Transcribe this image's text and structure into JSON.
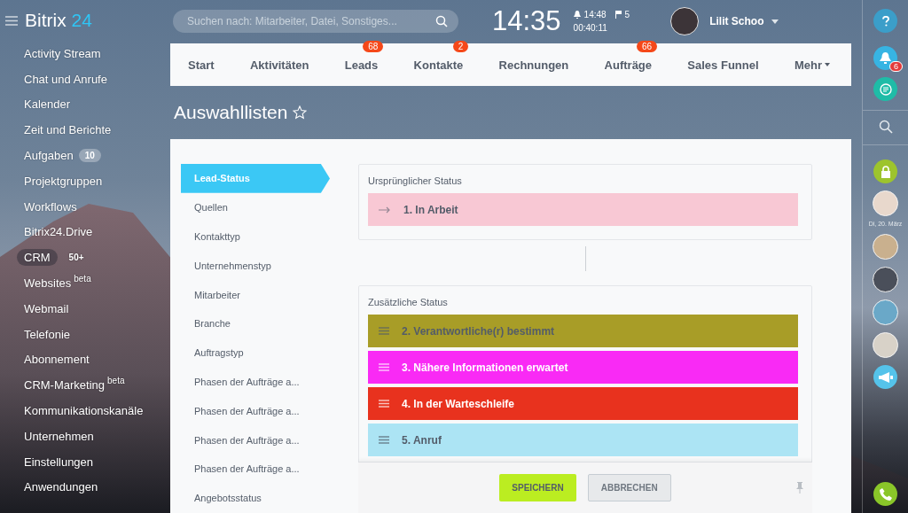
{
  "logo": {
    "name": "Bitrix",
    "number": "24"
  },
  "sidebar": {
    "items": [
      {
        "label": "Activity Stream",
        "selected": false
      },
      {
        "label": "Chat und Anrufe",
        "selected": false
      },
      {
        "label": "Kalender",
        "selected": false
      },
      {
        "label": "Zeit und Berichte",
        "selected": false
      },
      {
        "label": "Aufgaben",
        "count": "10",
        "selected": false
      },
      {
        "label": "Projektgruppen",
        "selected": false
      },
      {
        "label": "Workflows",
        "selected": false
      },
      {
        "label": "Bitrix24.Drive",
        "selected": false
      },
      {
        "label": "CRM",
        "count": "50+",
        "selected": true
      },
      {
        "label": "Websites",
        "sup": "beta",
        "selected": false
      },
      {
        "label": "Webmail",
        "selected": false
      },
      {
        "label": "Telefonie",
        "selected": false
      },
      {
        "label": "Abonnement",
        "selected": false
      },
      {
        "label": "CRM-Marketing",
        "sup": "beta",
        "selected": false
      },
      {
        "label": "Kommunikationskanäle",
        "selected": false
      },
      {
        "label": "Unternehmen",
        "selected": false
      },
      {
        "label": "Einstellungen",
        "selected": false
      },
      {
        "label": "Anwendungen",
        "selected": false
      }
    ]
  },
  "header": {
    "search": {
      "placeholder": "Suchen nach: Mitarbeiter, Datei, Sonstiges..."
    },
    "clock": "14:35",
    "alarm": "14:48",
    "flags": "5",
    "timer": "00:40:11",
    "user": "Lilit Schoo"
  },
  "nav": [
    {
      "label": "Start"
    },
    {
      "label": "Aktivitäten"
    },
    {
      "label": "Leads",
      "badge": "68"
    },
    {
      "label": "Kontakte",
      "badge": "2"
    },
    {
      "label": "Rechnungen"
    },
    {
      "label": "Aufträge",
      "badge": "66"
    },
    {
      "label": "Sales Funnel"
    },
    {
      "label": "Mehr",
      "dropdown": true
    }
  ],
  "page_title": "Auswahllisten",
  "lists": [
    {
      "label": "Lead-Status",
      "selected": true
    },
    {
      "label": "Quellen",
      "selected": false
    },
    {
      "label": "Kontakttyp",
      "selected": false
    },
    {
      "label": "Unternehmenstyp",
      "selected": false
    },
    {
      "label": "Mitarbeiter",
      "selected": false
    },
    {
      "label": "Branche",
      "selected": false
    },
    {
      "label": "Auftragstyp",
      "selected": false
    },
    {
      "label": "Phasen der Aufträge a...",
      "selected": false
    },
    {
      "label": "Phasen der Aufträge a...",
      "selected": false
    },
    {
      "label": "Phasen der Aufträge a...",
      "selected": false
    },
    {
      "label": "Phasen der Aufträge a...",
      "selected": false
    },
    {
      "label": "Angebotsstatus",
      "selected": false
    }
  ],
  "sections": [
    {
      "title": "Ursprünglicher Status",
      "statuses": [
        {
          "label": "1. In Arbeit",
          "kind": "initial",
          "color": "#f8c8d4"
        }
      ]
    },
    {
      "title": "Zusätzliche Status",
      "statuses": [
        {
          "label": "2. Verantwortliche(r) bestimmt",
          "kind": "draggable",
          "color": "#a89d27"
        },
        {
          "label": "3. Nähere Informationen erwartet",
          "kind": "draggable",
          "color": "#f92af5"
        },
        {
          "label": "4. In der Warteschleife",
          "kind": "draggable",
          "color": "#e8321e"
        },
        {
          "label": "5. Anruf",
          "kind": "draggable",
          "color": "#ace4f4"
        }
      ]
    }
  ],
  "buttons": [
    {
      "label": "SPEICHERN",
      "kind": "primary"
    },
    {
      "label": "ABBRECHEN",
      "kind": "secondary"
    }
  ],
  "rightbar": {
    "notifications": "6",
    "date": "Di, 20. März"
  }
}
